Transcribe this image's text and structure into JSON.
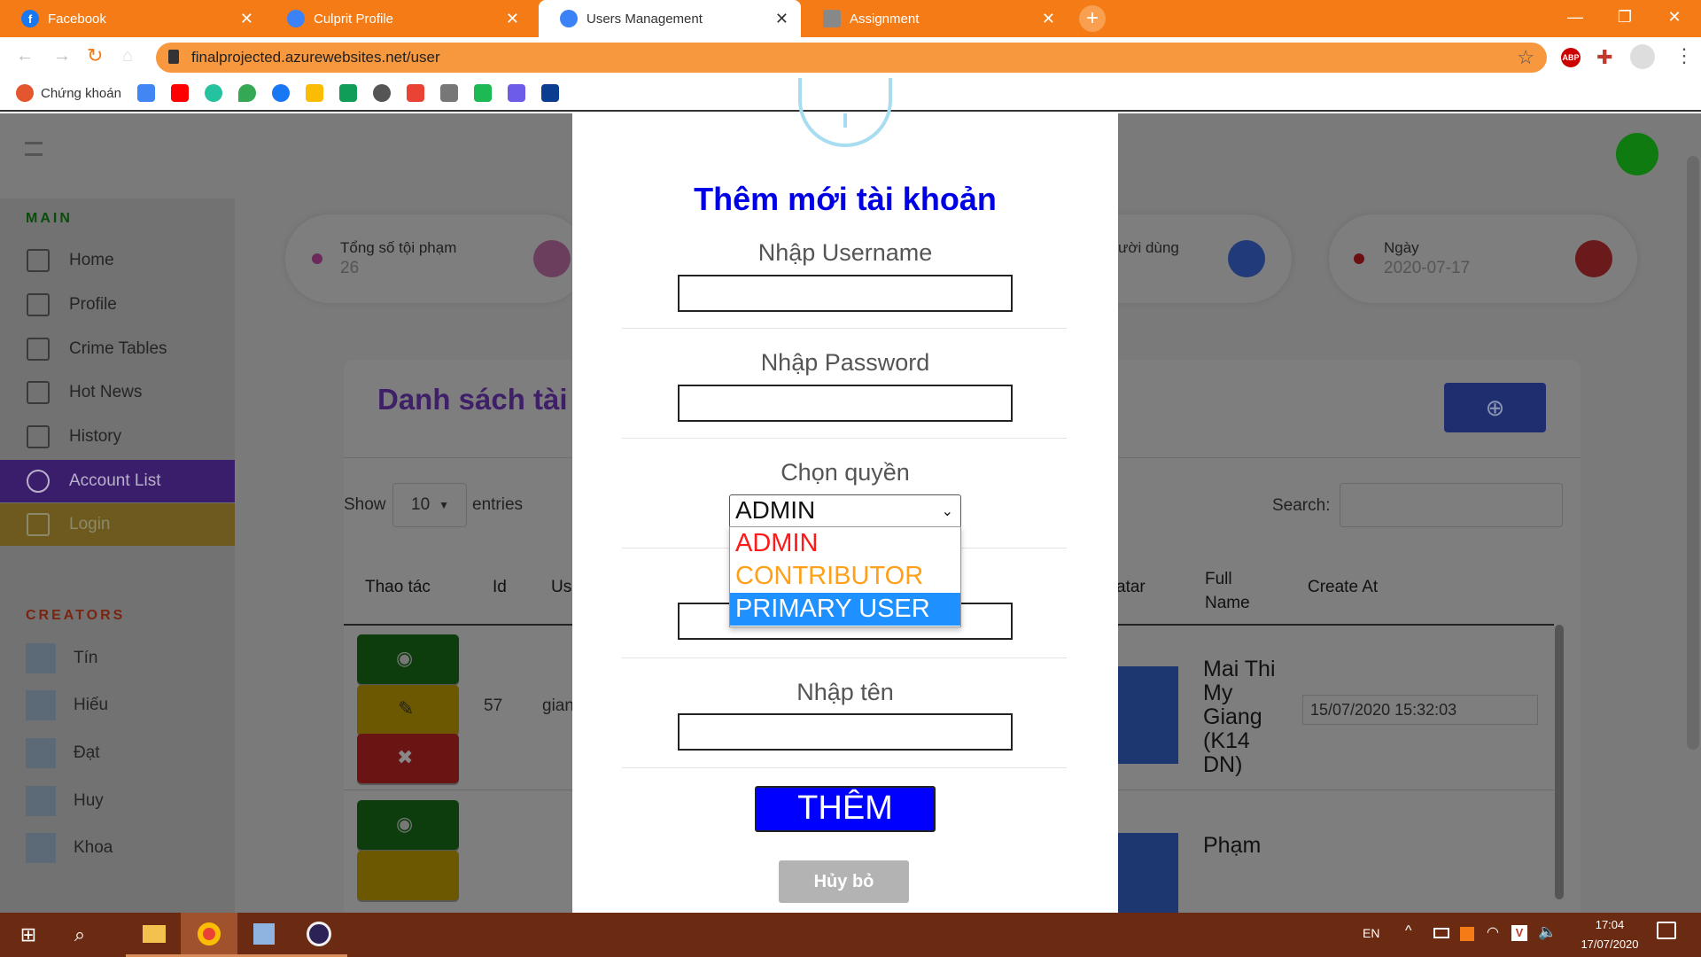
{
  "browser": {
    "tabs": [
      {
        "label": "Facebook",
        "icon": "facebook-icon",
        "color": "#1877f2"
      },
      {
        "label": "Culprit Profile",
        "icon": "chat-icon",
        "color": "#3b82f6"
      },
      {
        "label": "Users Management",
        "icon": "chat-icon",
        "color": "#3b82f6"
      },
      {
        "label": "Assignment",
        "icon": "document-icon",
        "color": "#888888"
      }
    ],
    "url": "finalprojected.azurewebsites.net/user",
    "bookmark_label": "Chứng khoán"
  },
  "sidebar": {
    "main_heading": "MAIN",
    "items": [
      {
        "label": "Home",
        "icon": "home-icon"
      },
      {
        "label": "Profile",
        "icon": "chart-icon"
      },
      {
        "label": "Crime Tables",
        "icon": "table-icon"
      },
      {
        "label": "Hot News",
        "icon": "clipboard-icon"
      },
      {
        "label": "History",
        "icon": "history-icon"
      },
      {
        "label": "Account List",
        "icon": "database-icon",
        "active": true
      },
      {
        "label": "Login",
        "icon": "login-icon"
      }
    ],
    "creators_heading": "CREATORS",
    "creators": [
      "Tín",
      "Hiếu",
      "Đạt",
      "Huy",
      "Khoa"
    ]
  },
  "cards": [
    {
      "label": "Tổng số tội phạm",
      "value": "26"
    },
    {
      "label": "ười dùng",
      "value": ""
    },
    {
      "label": "Ngày",
      "value": "2020-07-17"
    }
  ],
  "list": {
    "title": "Danh sách tài k",
    "show_label": "Show",
    "entries_value": "10",
    "entries_label": "entries",
    "search_label": "Search:",
    "columns": [
      "Thao tác",
      "Id",
      "Us",
      "atar",
      "Full Name",
      "Create At"
    ],
    "rows": [
      {
        "id": "57",
        "username": "gian",
        "full_name": "Mai Thi My Giang (K14 DN)",
        "created": "15/07/2020 15:32:03"
      },
      {
        "id": "",
        "username": "",
        "full_name": "Phạm",
        "created": ""
      }
    ]
  },
  "modal": {
    "title": "Thêm mới tài khoản",
    "username_label": "Nhập Username",
    "password_label": "Nhập Password",
    "role_label": "Chọn quyền",
    "role_selected": "ADMIN",
    "role_options": [
      {
        "label": "ADMIN",
        "color": "#ff1a1a"
      },
      {
        "label": "CONTRIBUTOR",
        "color": "#ff9f1a"
      },
      {
        "label": "PRIMARY USER",
        "color": "#ffffff",
        "highlighted": true
      }
    ],
    "name_label": "Nhập tên",
    "submit_label": "THÊM",
    "cancel_label": "Hủy bỏ"
  },
  "taskbar": {
    "lang": "EN",
    "time": "17:04",
    "date": "17/07/2020"
  },
  "colors": {
    "accent_orange": "#f47b16",
    "sidebar_active": "#3b1e6b",
    "sidebar_login": "#6e5a1e",
    "modal_title": "#0000e6",
    "submit_bg": "#0000ff"
  }
}
